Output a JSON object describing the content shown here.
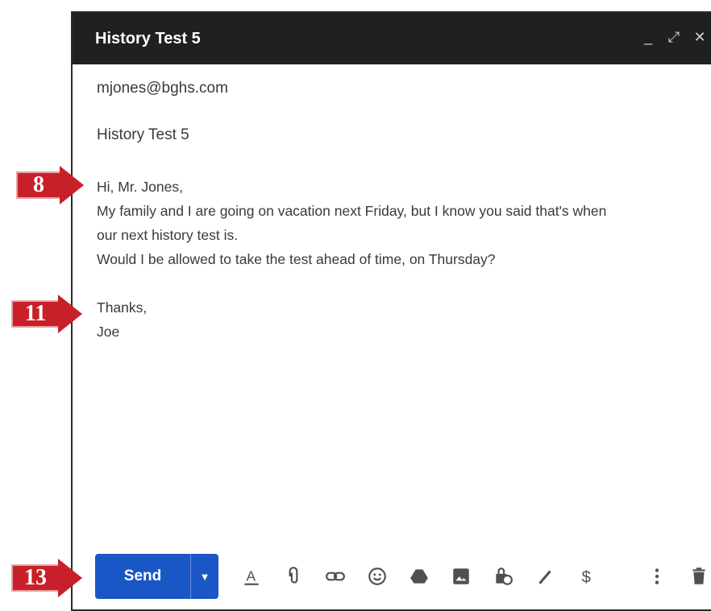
{
  "window": {
    "title": "History Test 5",
    "controls": {
      "minimize": "_",
      "expand": "⤢",
      "close": "✕"
    }
  },
  "email": {
    "to": "mjones@bghs.com",
    "subject": "History Test 5",
    "body": {
      "greeting": "Hi, Mr. Jones,",
      "line1": "My family and I are going on vacation next Friday, but I know you said that's when",
      "line2": "our next history test is.",
      "line3": "Would I be allowed to take the test ahead of time, on Thursday?",
      "closing": "Thanks,",
      "signature": "Joe"
    }
  },
  "toolbar": {
    "send_label": "Send",
    "send_more": "▼",
    "tools": [
      "format-text-icon",
      "attach-icon",
      "link-icon",
      "emoji-icon",
      "drive-icon",
      "photo-icon",
      "confidential-icon",
      "signature-icon",
      "money-icon",
      "more-options-icon",
      "trash-icon"
    ]
  },
  "markers": {
    "m1": "8",
    "m2": "11",
    "m3": "13"
  },
  "colors": {
    "titlebar": "#1f2022",
    "send": "#1a57c6",
    "marker": "#c8202a"
  }
}
